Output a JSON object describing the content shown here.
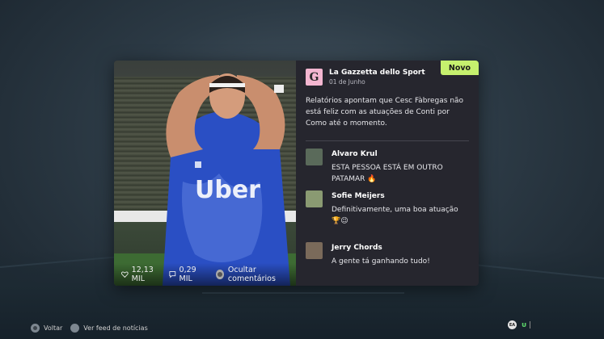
{
  "card": {
    "badge": "Novo",
    "source": {
      "logo_letter": "G",
      "name": "La Gazzetta dello Sport",
      "date": "01 de Junho"
    },
    "body": "Relatórios apontam que Cesc Fàbregas não está feliz com as atuações de Conti por Como até o momento.",
    "photo": {
      "likes": "12,13 MIL",
      "comments": "0,29 MIL",
      "hide_comments": "Ocultar comentários"
    },
    "comments": [
      {
        "name": "Alvaro Krul",
        "text": "ESTA PESSOA ESTÁ EM OUTRO PATAMAR 🔥",
        "avatar_color": "#5a6a5a"
      },
      {
        "name": "Sofie Meijers",
        "text": "Definitivamente, uma boa atuação 🏆😉",
        "avatar_color": "#8a9a72"
      },
      {
        "name": "Jerry Chords",
        "text": "A gente tá ganhando tudo!",
        "avatar_color": "#7a6a5a"
      }
    ]
  },
  "footer": {
    "back_label": "Voltar",
    "news_feed_label": "Ver feed de notícias"
  },
  "brand": {
    "ea": "EA",
    "ul": "ᴜ"
  },
  "colors": {
    "badge": "#c6f06e",
    "logo_bg": "#f3b6d0",
    "card_bg": "#26262e",
    "shirt": "#2a4fc4"
  }
}
